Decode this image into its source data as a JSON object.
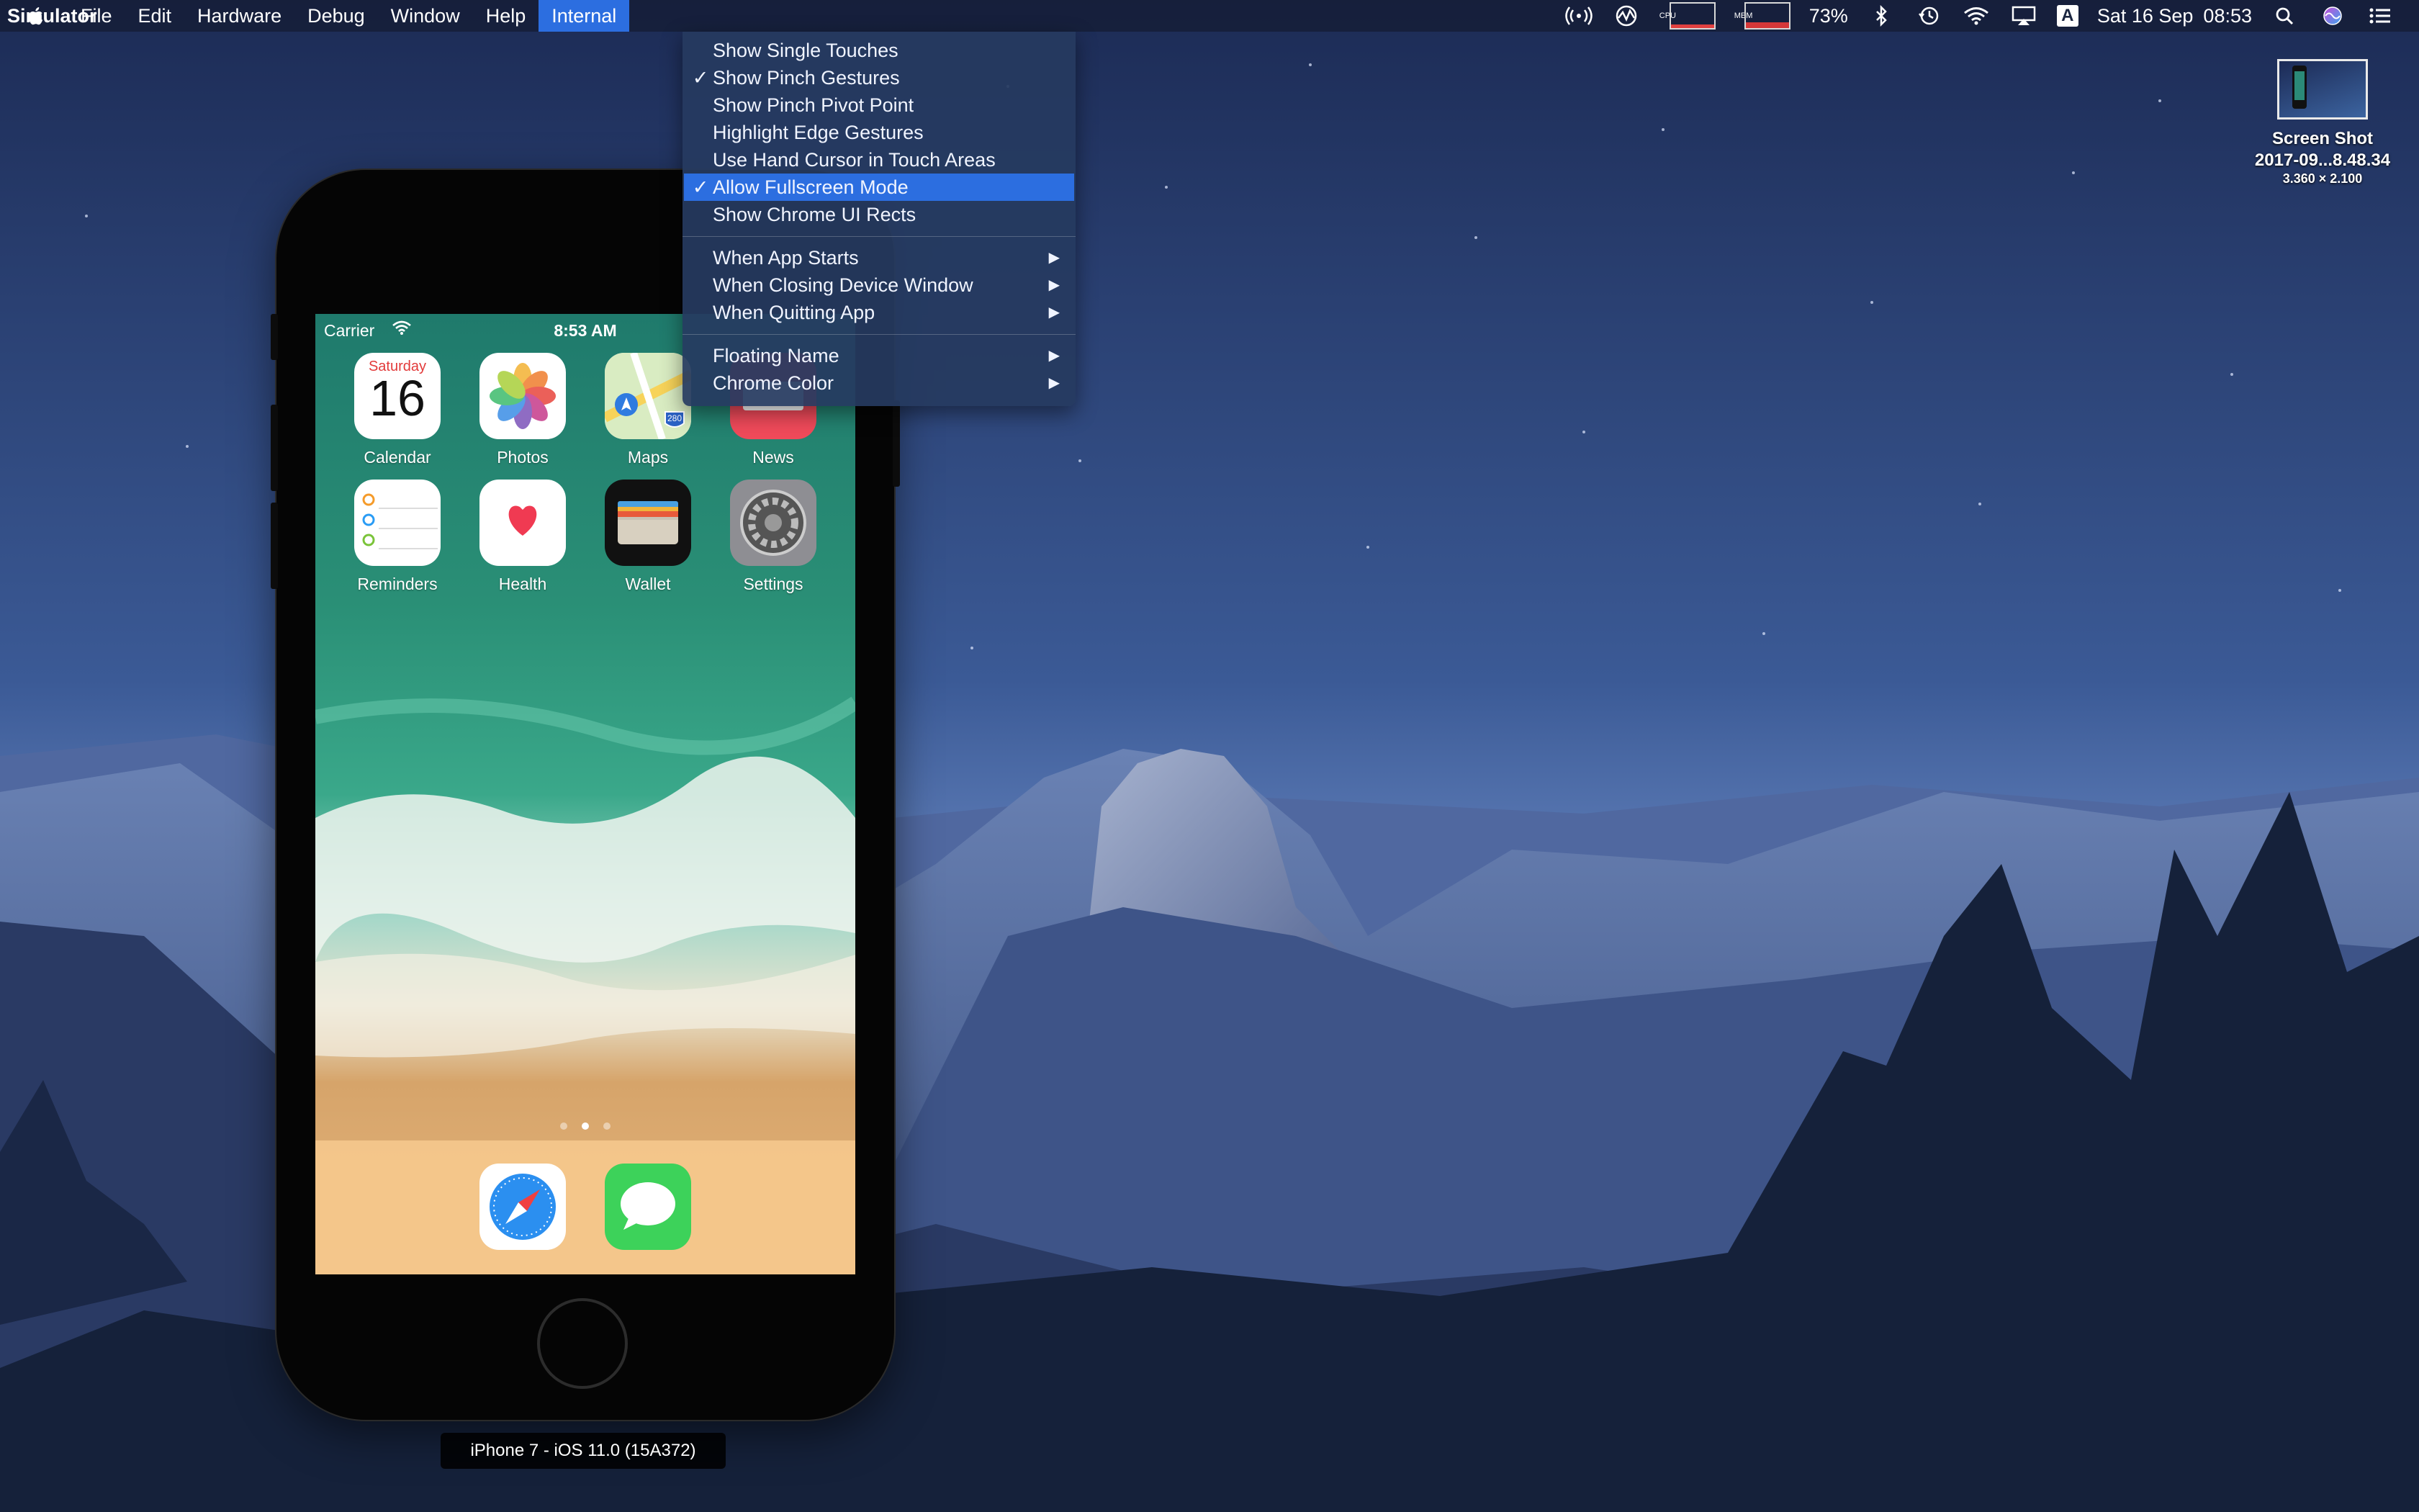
{
  "menubar": {
    "apple_icon": "apple-logo-icon",
    "app_name": "Simulator",
    "items": [
      "File",
      "Edit",
      "Hardware",
      "Debug",
      "Window",
      "Help",
      "Internal"
    ],
    "active_item": "Internal",
    "status": {
      "cpu_label": "CPU",
      "mem_label": "MEM",
      "battery_percent": "73%",
      "date": "Sat 16 Sep",
      "time": "08:53",
      "input_source": "A",
      "icons": [
        "broadcast-icon",
        "activity-icon",
        "bluetooth-icon",
        "time-machine-icon",
        "wifi-icon",
        "airplay-icon",
        "spotlight-icon",
        "siri-icon",
        "notification-center-icon"
      ]
    }
  },
  "internal_menu": {
    "group1": [
      {
        "label": "Show Single Touches",
        "checked": false
      },
      {
        "label": "Show Pinch Gestures",
        "checked": true
      },
      {
        "label": "Show Pinch Pivot Point",
        "checked": false
      },
      {
        "label": "Highlight Edge Gestures",
        "checked": false
      },
      {
        "label": "Use Hand Cursor in Touch Areas",
        "checked": false
      },
      {
        "label": "Allow Fullscreen Mode",
        "checked": true,
        "highlighted": true
      },
      {
        "label": "Show Chrome UI Rects",
        "checked": false
      }
    ],
    "group2": [
      {
        "label": "When App Starts",
        "submenu": true
      },
      {
        "label": "When Closing Device Window",
        "submenu": true
      },
      {
        "label": "When Quitting App",
        "submenu": true
      }
    ],
    "group3": [
      {
        "label": "Floating Name",
        "submenu": true
      },
      {
        "label": "Chrome Color",
        "submenu": true
      }
    ],
    "check_glyph": "✓",
    "arrow_glyph": "▶"
  },
  "desktop_file": {
    "name_line1": "Screen Shot",
    "name_line2": "2017-09...8.48.34",
    "dimensions": "3.360 × 2.100"
  },
  "simulator": {
    "status_bar": {
      "carrier": "Carrier",
      "time": "8:53 AM"
    },
    "apps_row1": [
      {
        "label": "Calendar",
        "icon": "calendar-icon"
      },
      {
        "label": "Photos",
        "icon": "photos-icon"
      },
      {
        "label": "Maps",
        "icon": "maps-icon"
      },
      {
        "label": "News",
        "icon": "news-icon"
      }
    ],
    "apps_row2": [
      {
        "label": "Reminders",
        "icon": "reminders-icon"
      },
      {
        "label": "Health",
        "icon": "health-icon"
      },
      {
        "label": "Wallet",
        "icon": "wallet-icon"
      },
      {
        "label": "Settings",
        "icon": "settings-icon"
      }
    ],
    "calendar": {
      "day": "Saturday",
      "date": "16"
    },
    "maps_badge": "280",
    "dock": [
      {
        "icon": "safari-icon"
      },
      {
        "icon": "messages-icon"
      }
    ],
    "page_count": 3,
    "current_page": 2,
    "device_caption": "iPhone 7 - iOS 11.0 (15A372)"
  },
  "colors": {
    "menu_highlight": "#2c6ee0",
    "menu_bg": "#263a60",
    "dock": "#f5c88c"
  }
}
